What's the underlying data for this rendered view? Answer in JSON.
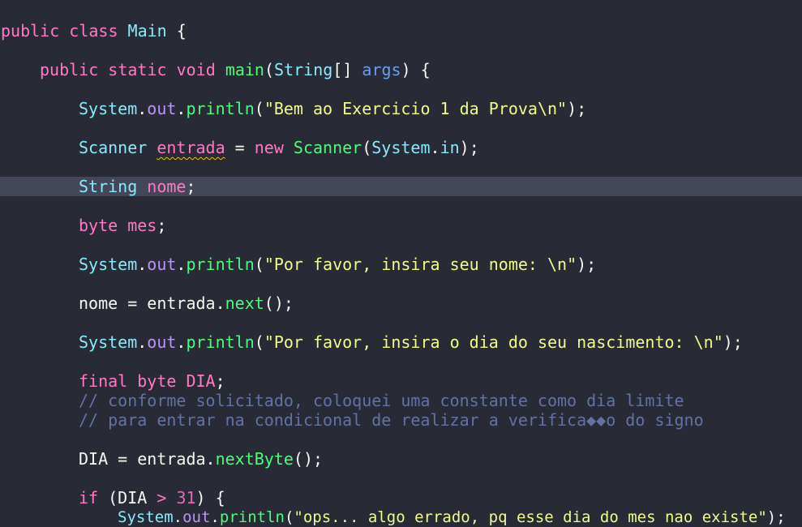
{
  "editor": {
    "colors": {
      "background": "#282a36",
      "current_line": "#44475a",
      "keyword": "#ff79c6",
      "type": "#8be9fd",
      "function": "#50fa7b",
      "string": "#f1fa8c",
      "comment": "#6272a4"
    },
    "current_line_index": 4,
    "lines": [
      {
        "indent": 0,
        "tokens": [
          [
            "kw",
            "public "
          ],
          [
            "kw",
            "class "
          ],
          [
            "type",
            "Main "
          ],
          [
            "pl",
            "{"
          ]
        ]
      },
      {
        "indent": 1,
        "tokens": [
          [
            "kw",
            "public "
          ],
          [
            "kw",
            "static "
          ],
          [
            "kw",
            "void "
          ],
          [
            "fn",
            "main"
          ],
          [
            "pl",
            "("
          ],
          [
            "type",
            "String"
          ],
          [
            "pl",
            "[] "
          ],
          [
            "param",
            "args"
          ],
          [
            "pl",
            ") {"
          ]
        ]
      },
      {
        "indent": 2,
        "tokens": [
          [
            "type",
            "System"
          ],
          [
            "pl",
            "."
          ],
          [
            "prop",
            "out"
          ],
          [
            "pl",
            "."
          ],
          [
            "fn",
            "println"
          ],
          [
            "pl",
            "("
          ],
          [
            "str",
            "\"Bem ao Exercicio 1 da Prova\\n\""
          ],
          [
            "pl",
            ");"
          ]
        ]
      },
      {
        "indent": 2,
        "tokens": [
          [
            "type",
            "Scanner "
          ],
          [
            "var squiggle",
            "entrada"
          ],
          [
            "pl",
            " = "
          ],
          [
            "kw",
            "new "
          ],
          [
            "fn",
            "Scanner"
          ],
          [
            "pl",
            "("
          ],
          [
            "type",
            "System"
          ],
          [
            "pl",
            "."
          ],
          [
            "type",
            "in"
          ],
          [
            "pl",
            ");"
          ]
        ]
      },
      {
        "indent": 2,
        "tokens": [
          [
            "type",
            "String "
          ],
          [
            "var",
            "nome"
          ],
          [
            "pl",
            ";"
          ]
        ]
      },
      {
        "indent": 2,
        "tokens": [
          [
            "kw",
            "byte "
          ],
          [
            "var",
            "mes"
          ],
          [
            "pl",
            ";"
          ]
        ]
      },
      {
        "indent": 2,
        "tokens": [
          [
            "type",
            "System"
          ],
          [
            "pl",
            "."
          ],
          [
            "prop",
            "out"
          ],
          [
            "pl",
            "."
          ],
          [
            "fn",
            "println"
          ],
          [
            "pl",
            "("
          ],
          [
            "str",
            "\"Por favor, insira seu nome: \\n\""
          ],
          [
            "pl",
            ");"
          ]
        ]
      },
      {
        "indent": 2,
        "tokens": [
          [
            "pl",
            "nome = entrada."
          ],
          [
            "fn",
            "next"
          ],
          [
            "pl",
            "();"
          ]
        ]
      },
      {
        "indent": 2,
        "tokens": [
          [
            "type",
            "System"
          ],
          [
            "pl",
            "."
          ],
          [
            "prop",
            "out"
          ],
          [
            "pl",
            "."
          ],
          [
            "fn",
            "println"
          ],
          [
            "pl",
            "("
          ],
          [
            "str",
            "\"Por favor, insira o dia do seu nascimento: \\n\""
          ],
          [
            "pl",
            ");"
          ]
        ]
      },
      {
        "indent": 2,
        "tokens": [
          [
            "kw",
            "final "
          ],
          [
            "kw",
            "byte "
          ],
          [
            "var",
            "DIA"
          ],
          [
            "pl",
            ";"
          ]
        ]
      },
      {
        "indent": 2,
        "tokens": [
          [
            "cm",
            "// conforme solicitado, coloquei uma constante como dia limite"
          ]
        ]
      },
      {
        "indent": 2,
        "tokens": [
          [
            "cm",
            "// para entrar na condicional de realizar a verifica◆◆o do signo"
          ]
        ]
      },
      {
        "indent": 2,
        "tokens": [
          [
            "pl",
            "DIA = entrada."
          ],
          [
            "fn",
            "nextByte"
          ],
          [
            "pl",
            "();"
          ]
        ]
      },
      {
        "indent": 2,
        "tokens": [
          [
            "kw",
            "if "
          ],
          [
            "pl",
            "(DIA "
          ],
          [
            "kw",
            "> "
          ],
          [
            "num",
            "31"
          ],
          [
            "pl",
            ") {"
          ]
        ]
      },
      {
        "indent": 3,
        "tokens": [
          [
            "type",
            "System"
          ],
          [
            "pl",
            "."
          ],
          [
            "prop",
            "out"
          ],
          [
            "pl",
            "."
          ],
          [
            "fn",
            "println"
          ],
          [
            "pl",
            "("
          ],
          [
            "str",
            "\"ops... algo errado, pq esse dia do mes nao existe\""
          ],
          [
            "pl",
            ");"
          ]
        ]
      }
    ]
  }
}
